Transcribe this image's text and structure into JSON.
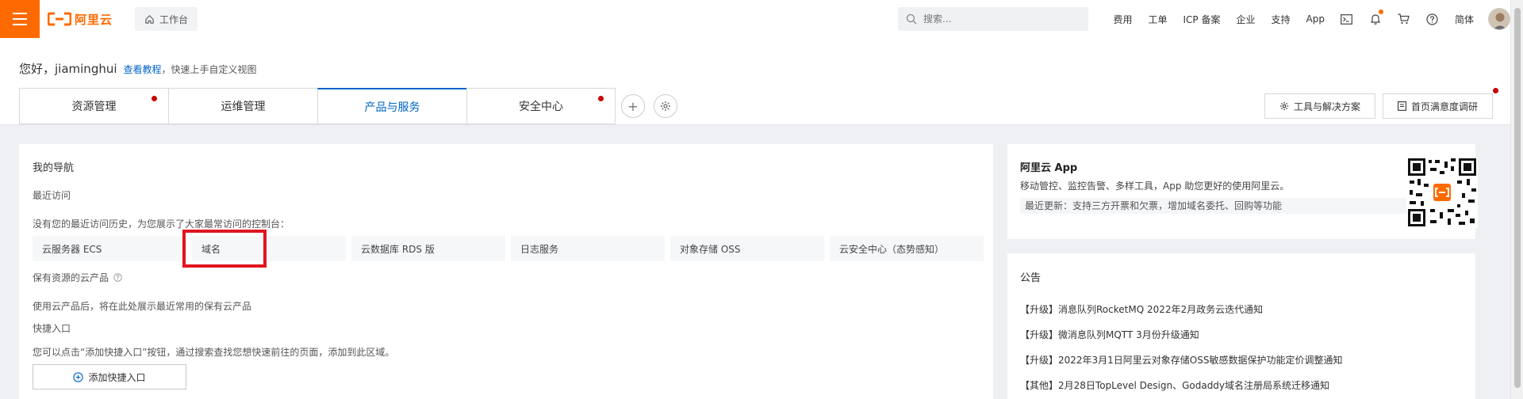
{
  "header": {
    "logo_text": "阿里云",
    "workbench_label": "工作台",
    "search_placeholder": "搜索...",
    "nav": [
      "费用",
      "工单",
      "ICP 备案",
      "企业",
      "支持",
      "App"
    ],
    "lang_label": "简体",
    "brand_color": "#ff6a00"
  },
  "greeting": {
    "hello": "您好，jiaminghui",
    "tutorial_link": "查看教程",
    "tip": "，快速上手自定义视图"
  },
  "tabs": [
    {
      "label": "资源管理",
      "badge": true,
      "active": false
    },
    {
      "label": "运维管理",
      "badge": false,
      "active": false
    },
    {
      "label": "产品与服务",
      "badge": false,
      "active": true
    },
    {
      "label": "安全中心",
      "badge": true,
      "active": false
    }
  ],
  "right_buttons": {
    "tools": "工具与解决方案",
    "survey": "首页满意度调研"
  },
  "main": {
    "title": "我的导航",
    "recent_title": "最近访问",
    "recent_desc": "没有您的最近访问历史，为您展示了大家最常访问的控制台：",
    "quick_items": [
      "云服务器 ECS",
      "域名",
      "云数据库 RDS 版",
      "日志服务",
      "对象存储 OSS",
      "云安全中心（态势感知）"
    ],
    "reserve_title": "保有资源的云产品",
    "reserve_desc": "使用云产品后，将在此处展示最近常用的保有云产品",
    "shortcut_title": "快捷入口",
    "shortcut_desc": "您可以点击“添加快捷入口”按钮，通过搜索查找您想快速前往的页面，添加到此区域。",
    "add_button": "添加快捷入口"
  },
  "app_card": {
    "title": "阿里云 App",
    "desc": "移动管控、监控告警、多样工具，App 助您更好的使用阿里云。",
    "update": "最近更新：支持三方开票和欠票，增加域名委托、回购等功能"
  },
  "notice": {
    "title": "公告",
    "items": [
      "【升级】消息队列RocketMQ 2022年2月政务云迭代通知",
      "【升级】微消息队列MQTT 3月份升级通知",
      "【升级】2022年3月1日阿里云对象存储OSS敏感数据保护功能定价调整通知",
      "【其他】2月28日TopLevel Design、Godaddy域名注册局系统迁移通知"
    ]
  },
  "colors": {
    "accent": "#0064c8",
    "badge": "#c80000",
    "highlight": "#e0151f"
  }
}
